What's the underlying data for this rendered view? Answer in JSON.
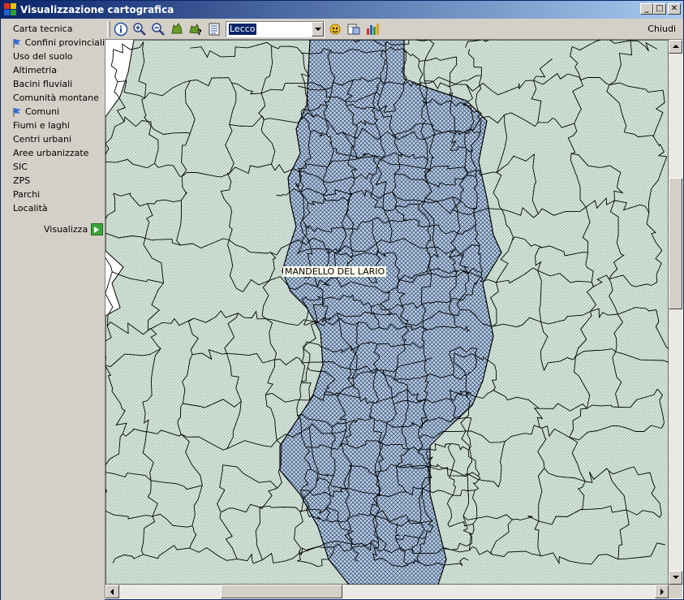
{
  "window": {
    "title": "Visualizzazione cartografica",
    "minimize": "_",
    "maximize": "□",
    "close": "✕"
  },
  "sidebar": {
    "layers": [
      {
        "label": "Carta tecnica",
        "active": false
      },
      {
        "label": "Confini provinciali",
        "active": true
      },
      {
        "label": "Uso del suolo",
        "active": false
      },
      {
        "label": "Altimetria",
        "active": false
      },
      {
        "label": "Bacini fluviali",
        "active": false
      },
      {
        "label": "Comunità montane",
        "active": false
      },
      {
        "label": "Comuni",
        "active": true
      },
      {
        "label": "Fiumi e laghi",
        "active": false
      },
      {
        "label": "Centri urbani",
        "active": false
      },
      {
        "label": "Aree urbanizzate",
        "active": false
      },
      {
        "label": "SIC",
        "active": false
      },
      {
        "label": "ZPS",
        "active": false
      },
      {
        "label": "Parchi",
        "active": false
      },
      {
        "label": "Località",
        "active": false
      }
    ],
    "visualizza_label": "Visualizza"
  },
  "toolbar": {
    "icons": [
      "info-icon",
      "zoom-in-icon",
      "zoom-out-icon",
      "pan-icon",
      "identify-icon",
      "legend-icon",
      "locate-icon",
      "export-icon",
      "chart-icon"
    ],
    "province_combo_value": "Lecco",
    "close_label": "Chiudi"
  },
  "map": {
    "highlight_label": "MANDELLO DEL LARIO",
    "colors": {
      "base_fill": "#cfe0d6",
      "selected_fill": "#9fb8cc",
      "border": "#000000"
    }
  }
}
